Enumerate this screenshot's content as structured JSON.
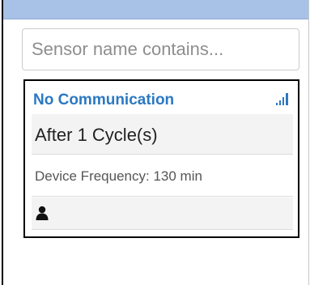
{
  "search": {
    "placeholder": "Sensor name contains...",
    "value": ""
  },
  "card": {
    "title": "No Communication",
    "cycle_text": "After 1 Cycle(s)",
    "frequency_text": "Device Frequency: 130 min",
    "status_icon": "signal-bars-icon",
    "user_icon": "user-icon"
  },
  "colors": {
    "top_bar": "#a7c2e6",
    "title": "#2b78c2",
    "card_border": "#000000",
    "row_alt": "#f3f3f3"
  }
}
